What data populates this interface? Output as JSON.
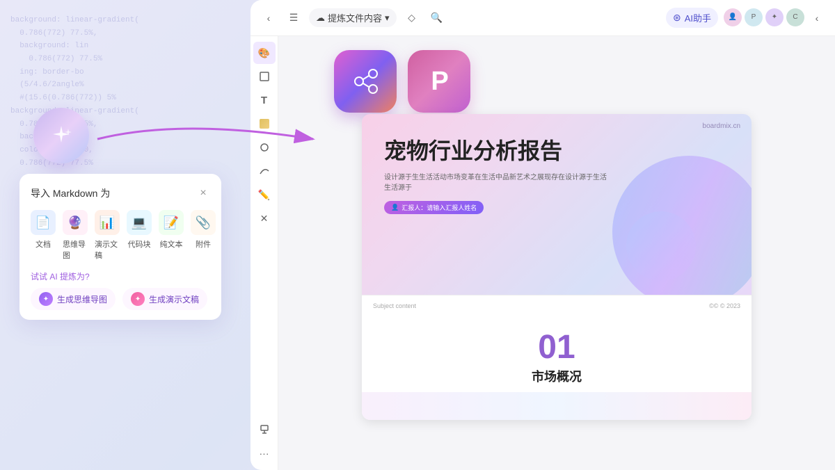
{
  "app": {
    "title": "提炼文件内容"
  },
  "toolbar": {
    "breadcrumb": "提炼文件内容",
    "ai_assistant": "AI助手",
    "back_label": "←",
    "menu_label": "☰"
  },
  "dropdown": {
    "title": "导入 Markdown 为",
    "close_label": "×",
    "items": [
      {
        "label": "文档",
        "icon": "📄"
      },
      {
        "label": "思维导图",
        "icon": "🔮"
      },
      {
        "label": "演示文稿",
        "icon": "📊"
      },
      {
        "label": "代码块",
        "icon": "💻"
      },
      {
        "label": "纯文本",
        "icon": "📝"
      },
      {
        "label": "附件",
        "icon": "📎"
      }
    ],
    "ai_label": "试试 AI 提炼为?",
    "ai_actions": [
      {
        "label": "生成思维导图",
        "type": "purple"
      },
      {
        "label": "生成演示文稿",
        "type": "pink"
      }
    ]
  },
  "slide": {
    "branding": "boardmix.cn",
    "title": "宠物行业分析报告",
    "subtitle": "设计源于生生活活动市场变革在生活中品新艺术之展现存在设计源于生活生活源于",
    "tag": "汇报人：请输入汇报人姓名",
    "section_header_left": "Subject content",
    "section_header_right": "©© © 2023",
    "section_number": "01",
    "section_title": "市场概况"
  },
  "sidebar": {
    "icons": [
      "🎨",
      "⬜",
      "T",
      "🟡",
      "⭕",
      "〰",
      "✏️",
      "✕",
      "⚡",
      "···"
    ]
  },
  "bg_code_lines": [
    "background: linear-gradient(",
    "  0.786(772) 77.5%,",
    "  background: lin",
    "    0.786(772) 77.5%",
    "  ing: border-bo",
    "  (5/4.6/2angle%",
    "  #(15.6(0.786(772)) 5%"
  ],
  "colors": {
    "accent_purple": "#9060d0",
    "accent_pink": "#e060d0",
    "brand_gradient_start": "#c8b8f0",
    "brand_gradient_end": "#b8c8f8"
  }
}
